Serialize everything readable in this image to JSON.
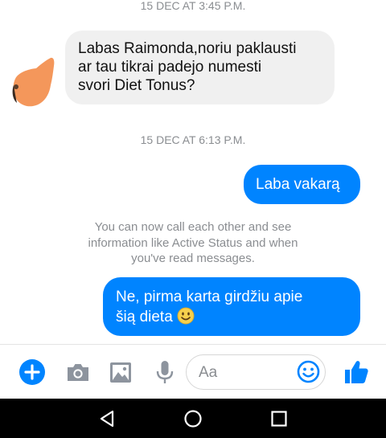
{
  "chat": {
    "timestamps": [
      "15 DEC AT 3:45 P.M.",
      "15 DEC AT 6:13 P.M."
    ],
    "messages": [
      {
        "direction": "incoming",
        "lines": [
          "Labas Raimonda,noriu paklausti",
          "ar tau tikrai padejo numesti",
          "svori Diet Tonus?"
        ]
      },
      {
        "direction": "outgoing",
        "text": "Laba vakarą"
      },
      {
        "direction": "outgoing",
        "lines": [
          "Ne, pirma karta girdžiu apie",
          "šią dieta"
        ],
        "emoji": "slightly-smiling-face"
      }
    ],
    "notice_lines": [
      "You can now call each other and see",
      "information like Active Status and when",
      "you've read messages."
    ]
  },
  "composer": {
    "placeholder": "Aa",
    "icons": [
      "plus-icon",
      "camera-icon",
      "image-icon",
      "microphone-icon",
      "emoji-icon",
      "thumbs-up-icon"
    ]
  },
  "navbar": {
    "icons": [
      "back-icon",
      "home-icon",
      "recent-apps-icon"
    ]
  },
  "colors": {
    "accent": "#0084ff",
    "incoming_bubble": "#f0f0f0",
    "meta_text": "#8a8d91",
    "avatar": "#f4975b",
    "navbar": "#000000"
  }
}
